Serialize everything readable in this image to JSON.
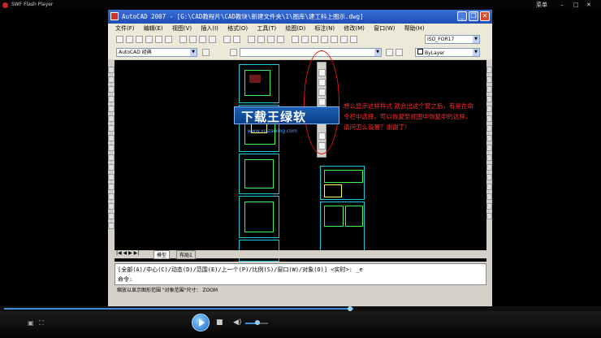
{
  "player": {
    "title": "SWF Flash Player",
    "menu_label": "菜单",
    "colors": {
      "accent": "#3a8fd8",
      "bg": "#000000"
    }
  },
  "cad": {
    "title": "AutoCAD 2007 - [G:\\CAD教程片\\CAD教块\\新建文件夹\\1\\图库\\建工科上图示.dwg]",
    "menu": [
      "文件(F)",
      "编辑(E)",
      "视图(V)",
      "插入(I)",
      "格式(O)",
      "工具(T)",
      "绘图(D)",
      "标注(N)",
      "修改(M)",
      "窗口(W)",
      "帮助(H)"
    ],
    "style_combo": "ISO_FOR17",
    "workspace_combo": "AutoCAD 经典",
    "layer_combo": "ByLayer",
    "tabs": [
      "模型",
      "布局1"
    ],
    "command_lines": [
      "[全部(A)/中心(C)/动态(D)/范围(E)/上一个(P)/比例(S)/窗口(W)/对象(O)] <实时>: _e",
      "命令:"
    ],
    "status_text": "缩放以显示图形范围 \"对象范围\"尺寸：  ZOOM"
  },
  "overlay": {
    "watermark": "下载王绿软",
    "watermark_url": "www.xiazaiking.com",
    "annotation": "想么显示这样样式 就会出这个窗之后，有是在命令栏中选择，可以恢复至视图中恢复中的这样，请问怎么设置？谢谢了！"
  }
}
